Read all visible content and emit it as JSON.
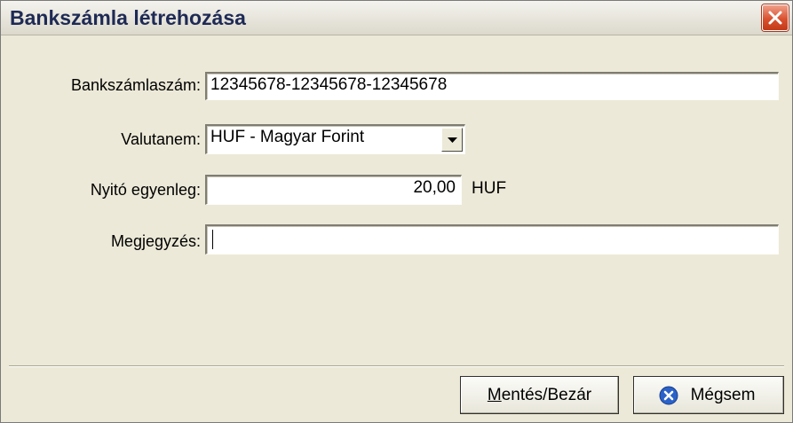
{
  "window": {
    "title": "Bankszámla létrehozása"
  },
  "form": {
    "account_number": {
      "label": "Bankszámlaszám:",
      "value": "12345678-12345678-12345678"
    },
    "currency": {
      "label": "Valutanem:",
      "selected": "HUF - Magyar Forint"
    },
    "opening_balance": {
      "label": "Nyitó egyenleg:",
      "value": "20,00",
      "unit": "HUF"
    },
    "note": {
      "label": "Megjegyzés:",
      "value": ""
    }
  },
  "buttons": {
    "save_close_mnemonic": "M",
    "save_close_rest": "entés/Bezár",
    "cancel": "Mégsem"
  },
  "icons": {
    "close": "close-icon",
    "combo": "chevron-down-icon",
    "cancel": "cancel-x-icon"
  },
  "colors": {
    "close_button": "#d9512f",
    "cancel_icon": "#2a62c9"
  }
}
